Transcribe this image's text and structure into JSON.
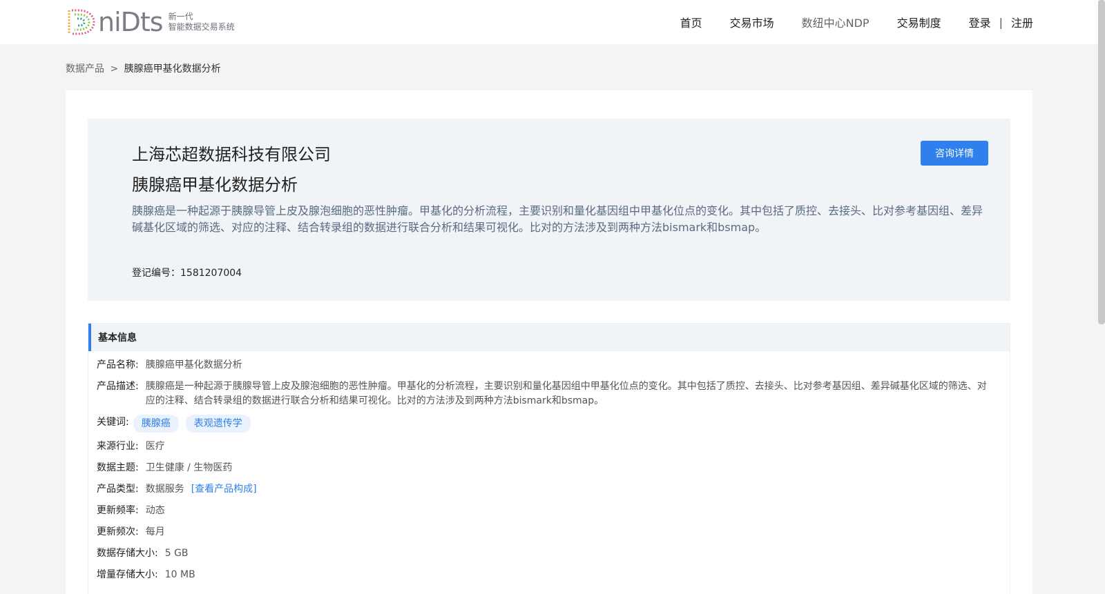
{
  "header": {
    "logo_word": "niDts",
    "logo_sub_line1": "新一代",
    "logo_sub_line2": "智能数据交易系统",
    "nav": [
      "首页",
      "交易市场",
      "数纽中心NDP",
      "交易制度"
    ],
    "login": "登录",
    "separator": "|",
    "register": "注册"
  },
  "breadcrumb": {
    "parent": "数据产品",
    "gt": ">",
    "current": "胰腺癌甲基化数据分析"
  },
  "hero": {
    "company": "上海芯超数据科技有限公司",
    "product": "胰腺癌甲基化数据分析",
    "description": "胰腺癌是一种起源于胰腺导管上皮及腺泡细胞的恶性肿瘤。甲基化的分析流程，主要识别和量化基因组中甲基化位点的变化。其中包括了质控、去接头、比对参考基因组、差异碱基化区域的筛选、对应的注释、结合转录组的数据进行联合分析和结果可视化。比对的方法涉及到两种方法bismark和bsmap。",
    "reg_label": "登记编号：",
    "reg_no": "1581207004",
    "consult_button": "咨询详情"
  },
  "basic_info": {
    "title": "基本信息",
    "name_label": "产品名称:",
    "name_value": "胰腺癌甲基化数据分析",
    "desc_label": "产品描述:",
    "desc_value": "胰腺癌是一种起源于胰腺导管上皮及腺泡细胞的恶性肿瘤。甲基化的分析流程，主要识别和量化基因组中甲基化位点的变化。其中包括了质控、去接头、比对参考基因组、差异碱基化区域的筛选、对应的注释、结合转录组的数据进行联合分析和结果可视化。比对的方法涉及到两种方法bismark和bsmap。",
    "keywords_label": "关键词:",
    "keywords": [
      "胰腺癌",
      "表观遗传学"
    ],
    "industry_label": "来源行业:",
    "industry_value": "医疗",
    "theme_label": "数据主题:",
    "theme_value": "卫生健康 / 生物医药",
    "type_label": "产品类型:",
    "type_value": "数据服务",
    "type_link": "[查看产品构成]",
    "freq_label": "更新频率:",
    "freq_value": "动态",
    "times_label": "更新频次:",
    "times_value": "每月",
    "storage_label": "数据存储大小:",
    "storage_value": "5 GB",
    "incr_label": "增量存储大小:",
    "incr_value": "10 MB"
  },
  "colors": {
    "accent": "#2f80ed",
    "hero_bg": "#f1f4f7",
    "page_bg": "#f4f4f4"
  }
}
